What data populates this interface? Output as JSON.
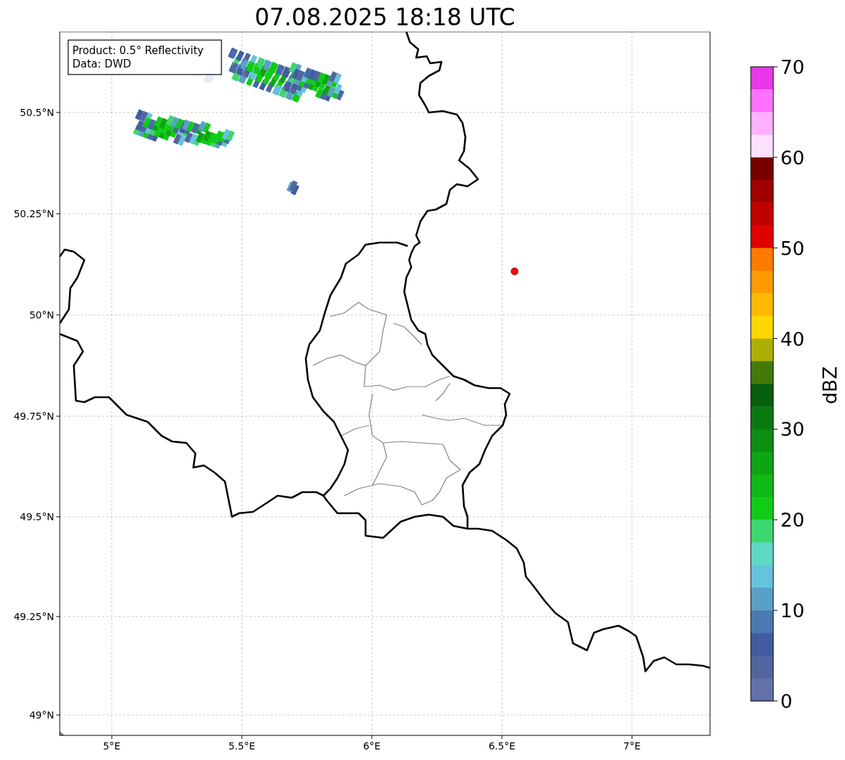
{
  "title": "07.08.2025 18:18 UTC",
  "info_box": {
    "lines": [
      "Product: 0.5° Reflectivity",
      "Data: DWD"
    ]
  },
  "map": {
    "x_ticks": [
      "5°E",
      "5.5°E",
      "6°E",
      "6.5°E",
      "7°E"
    ],
    "y_ticks": [
      "50.5°N",
      "50.25°N",
      "50°N",
      "49.75°N",
      "49.5°N",
      "49.25°N",
      "49°N"
    ]
  },
  "colorbar": {
    "label": "dBZ",
    "ticks": [
      "70",
      "60",
      "50",
      "40",
      "30",
      "20",
      "10",
      "0"
    ],
    "bands": [
      {
        "color": "#e838e8"
      },
      {
        "color": "#ff70ff"
      },
      {
        "color": "#ffb0ff"
      },
      {
        "color": "#ffe0ff"
      },
      {
        "color": "#780000"
      },
      {
        "color": "#a00000"
      },
      {
        "color": "#c00000"
      },
      {
        "color": "#e00000"
      },
      {
        "color": "#ff7a00"
      },
      {
        "color": "#ff9a00"
      },
      {
        "color": "#ffb800"
      },
      {
        "color": "#ffd700"
      },
      {
        "color": "#adb004"
      },
      {
        "color": "#447a0a"
      },
      {
        "color": "#075e0c"
      },
      {
        "color": "#0a7a10"
      },
      {
        "color": "#0b8e12"
      },
      {
        "color": "#0ea414"
      },
      {
        "color": "#10b818"
      },
      {
        "color": "#10cc18"
      },
      {
        "color": "#3ed66e"
      },
      {
        "color": "#5fd8c6"
      },
      {
        "color": "#66c3dd"
      },
      {
        "color": "#5a9fc7"
      },
      {
        "color": "#4a7ab1"
      },
      {
        "color": "#425ca0"
      },
      {
        "color": "#52669e"
      },
      {
        "color": "#6272a8"
      }
    ]
  }
}
